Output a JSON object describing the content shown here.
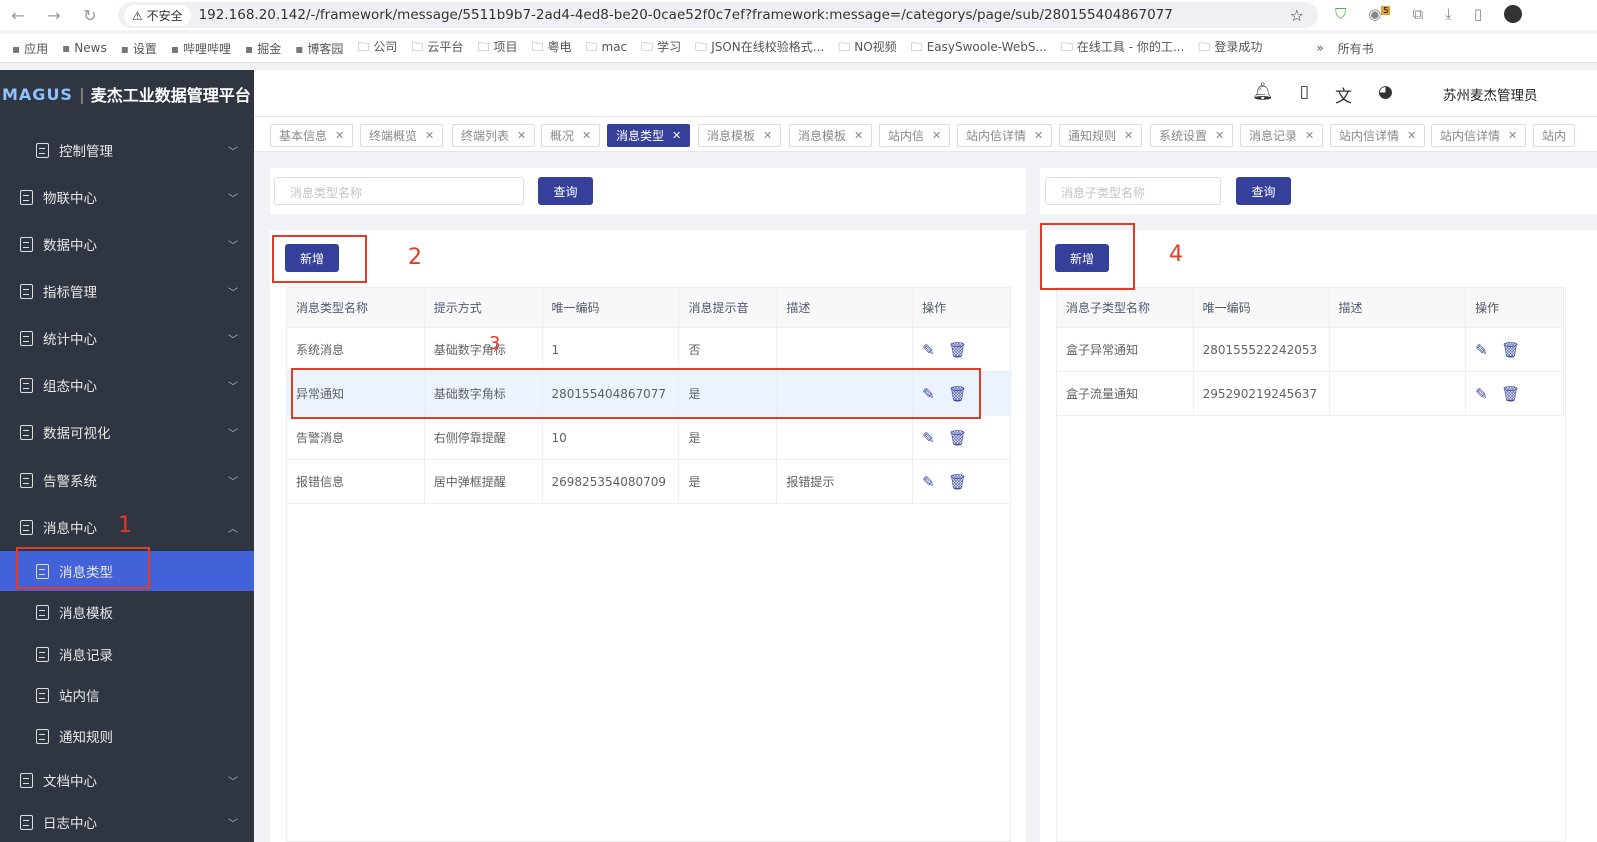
{
  "browser": {
    "insecure_label": "不安全",
    "url": "192.168.20.142/-/framework/message/5511b9b7-2ad4-4ed8-be20-0cae52f0c7ef?framework:message=/categorys/page/sub/280155404867077",
    "ext_badge": "5"
  },
  "bookmarks": [
    "应用",
    "News",
    "设置",
    "哔哩哔哩",
    "掘金",
    "博客园",
    "公司",
    "云平台",
    "项目",
    "粤电",
    "mac",
    "学习",
    "JSON在线校验格式...",
    "NO视频",
    "EasySwoole-WebS...",
    "在线工具 - 你的工...",
    "登录成功"
  ],
  "bookmarks_more": "»",
  "bookmarks_all": "所有书",
  "app": {
    "brand": "MAGUS",
    "title": "麦杰工业数据管理平台",
    "user": "苏州麦杰管理员"
  },
  "sidebar": {
    "items": [
      {
        "label": "控制管理",
        "sub": true
      },
      {
        "label": "物联中心"
      },
      {
        "label": "数据中心"
      },
      {
        "label": "指标管理"
      },
      {
        "label": "统计中心"
      },
      {
        "label": "组态中心"
      },
      {
        "label": "数据可视化"
      },
      {
        "label": "告警系统"
      },
      {
        "label": "消息中心",
        "open": true
      },
      {
        "label": "消息类型",
        "sub": true,
        "active": true
      },
      {
        "label": "消息模板",
        "sub": true
      },
      {
        "label": "消息记录",
        "sub": true
      },
      {
        "label": "站内信",
        "sub": true
      },
      {
        "label": "通知规则",
        "sub": true
      },
      {
        "label": "文档中心"
      },
      {
        "label": "日志中心"
      }
    ]
  },
  "tabs": [
    {
      "label": "基本信息"
    },
    {
      "label": "终端概览"
    },
    {
      "label": "终端列表"
    },
    {
      "label": "概况"
    },
    {
      "label": "消息类型",
      "active": true
    },
    {
      "label": "消息模板"
    },
    {
      "label": "消息模板"
    },
    {
      "label": "站内信"
    },
    {
      "label": "站内信详情"
    },
    {
      "label": "通知规则"
    },
    {
      "label": "系统设置"
    },
    {
      "label": "消息记录"
    },
    {
      "label": "站内信详情"
    },
    {
      "label": "站内信详情"
    },
    {
      "label": "站内"
    }
  ],
  "left": {
    "search_placeholder": "消息类型名称",
    "query": "查询",
    "add": "新增",
    "columns": [
      "消息类型名称",
      "提示方式",
      "唯一编码",
      "消息提示音",
      "描述",
      "操作"
    ],
    "rows": [
      [
        "系统消息",
        "基础数字角标",
        "1",
        "否",
        ""
      ],
      [
        "异常通知",
        "基础数字角标",
        "280155404867077",
        "是",
        ""
      ],
      [
        "告警消息",
        "右侧停靠提醒",
        "10",
        "是",
        ""
      ],
      [
        "报错信息",
        "居中弹框提醒",
        "269825354080709",
        "是",
        "报错提示"
      ]
    ],
    "highlighted_row": 1
  },
  "right": {
    "search_placeholder": "消息子类型名称",
    "query": "查询",
    "add": "新增",
    "columns": [
      "消息子类型名称",
      "唯一编码",
      "描述",
      "操作"
    ],
    "rows": [
      [
        "盒子异常通知",
        "280155522242053",
        ""
      ],
      [
        "盒子流量通知",
        "295290219245637",
        ""
      ]
    ]
  },
  "annotations": [
    "1",
    "2",
    "3",
    "4"
  ],
  "colors": {
    "primary": "#34409a",
    "sidebar": "#2f3541",
    "active": "#4361d8",
    "annotation": "#e23b26"
  }
}
